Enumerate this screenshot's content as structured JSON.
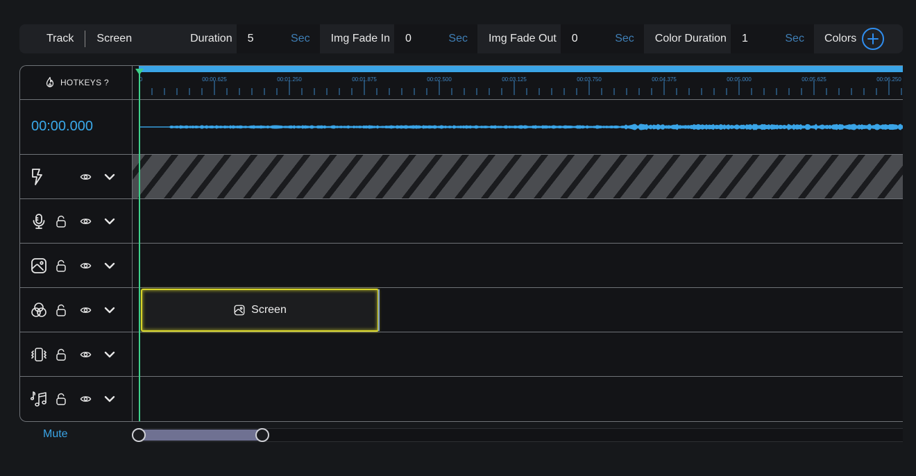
{
  "toolbar": {
    "track_label": "Track",
    "screen_label": "Screen",
    "duration_label": "Duration",
    "duration_value": "5",
    "duration_unit": "Sec",
    "fade_in_label": "Img Fade In",
    "fade_in_value": "0",
    "fade_in_unit": "Sec",
    "fade_out_label": "Img Fade Out",
    "fade_out_value": "0",
    "fade_out_unit": "Sec",
    "color_duration_label": "Color Duration",
    "color_duration_value": "1",
    "color_duration_unit": "Sec",
    "colors_label": "Colors",
    "add_icon": "plus-circle-icon"
  },
  "timeline": {
    "hotkeys_label": "HOTKEYS ?",
    "hotkeys_icon": "flame-icon",
    "timecode": "00:00.000",
    "ruler_ticks": [
      "0",
      "00:00.625",
      "00:01.250",
      "00:01.875",
      "00:02.500",
      "00:03.125",
      "00:03.750",
      "00:04.375",
      "00:05.000",
      "00:05.625",
      "00:06.250"
    ],
    "tracks": [
      {
        "icon": "lightning-icon",
        "locked": false,
        "has_lock": false
      },
      {
        "icon": "microphone-icon",
        "has_lock": true
      },
      {
        "icon": "image-icon",
        "has_lock": true
      },
      {
        "icon": "color-circles-icon",
        "has_lock": true
      },
      {
        "icon": "vibrate-icon",
        "has_lock": true
      },
      {
        "icon": "music-notes-icon",
        "has_lock": true
      }
    ],
    "clip": {
      "label": "Screen",
      "icon": "image-icon"
    }
  },
  "footer": {
    "mute_label": "Mute"
  },
  "colors": {
    "accent": "#3aa4e6",
    "playhead": "#3ed08a",
    "clip_border": "#d8d62a"
  }
}
